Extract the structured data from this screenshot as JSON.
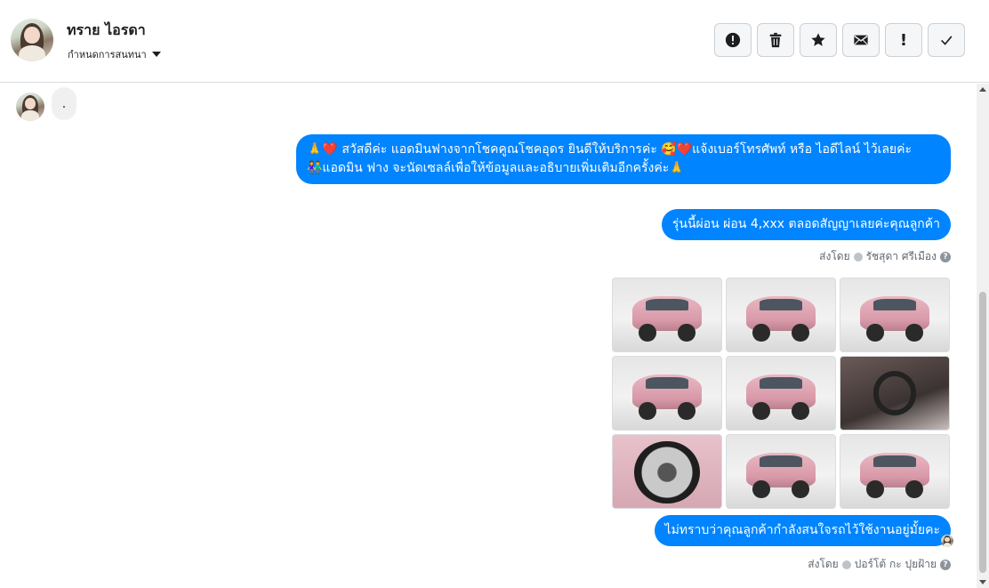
{
  "header": {
    "name": "ทราย ไอรดา",
    "assign_label": "กำหนดการสนทนา"
  },
  "toolbar": {
    "buttons": [
      {
        "name": "spam-button",
        "icon": "alert-circle-icon"
      },
      {
        "name": "delete-button",
        "icon": "trash-icon"
      },
      {
        "name": "star-button",
        "icon": "star-icon"
      },
      {
        "name": "mark-unread-button",
        "icon": "envelope-icon",
        "label": ""
      },
      {
        "name": "important-button",
        "icon": "exclamation-icon",
        "label": "!"
      },
      {
        "name": "done-button",
        "icon": "check-icon",
        "label": "✓"
      }
    ]
  },
  "messages": {
    "incoming": ".",
    "out1_line1": "🙏❤️ สวัสดีค่ะ แอดมินฟางจากโชคคูณโชคอุดร ยินดีให้บริการค่ะ 🥰❤️แจ้งเบอร์โทรศัพท์ หรือ ไอดีไลน์ ไว้เลยค่ะ",
    "out1_line2": "👫แอดมิน ฟาง จะนัดเซลล์เพื่อให้ข้อมูลและอธิบายเพิ่มเติมอีกครั้งค่ะ🙏",
    "out2": "รุ่นนี้ผ่อน ผ่อน 4,xxx ตลอดสัญญาเลยค่ะคุณลูกค้า",
    "out3": "ไม่ทราบว่าคุณลูกค้ากำลังสนใจรถไว้ใช้งานอยู่มั้ยคะ"
  },
  "sent_by": {
    "prefix": "ส่งโดย",
    "first_sender": "รัชสุดา ศรีเมือง",
    "second_sender": "ปอร์โต้ กะ ปุยฝ้าย"
  },
  "photos": [
    {
      "name": "car-front-view"
    },
    {
      "name": "car-front-angle"
    },
    {
      "name": "car-side-view"
    },
    {
      "name": "car-side-rear"
    },
    {
      "name": "car-rear-view"
    },
    {
      "name": "car-interior-dashboard"
    },
    {
      "name": "car-wheel-closeup"
    },
    {
      "name": "car-rear-angle"
    },
    {
      "name": "car-rear-angle-2"
    }
  ],
  "colors": {
    "bubble_out": "#0084ff",
    "bubble_in": "#f0f0f0"
  }
}
